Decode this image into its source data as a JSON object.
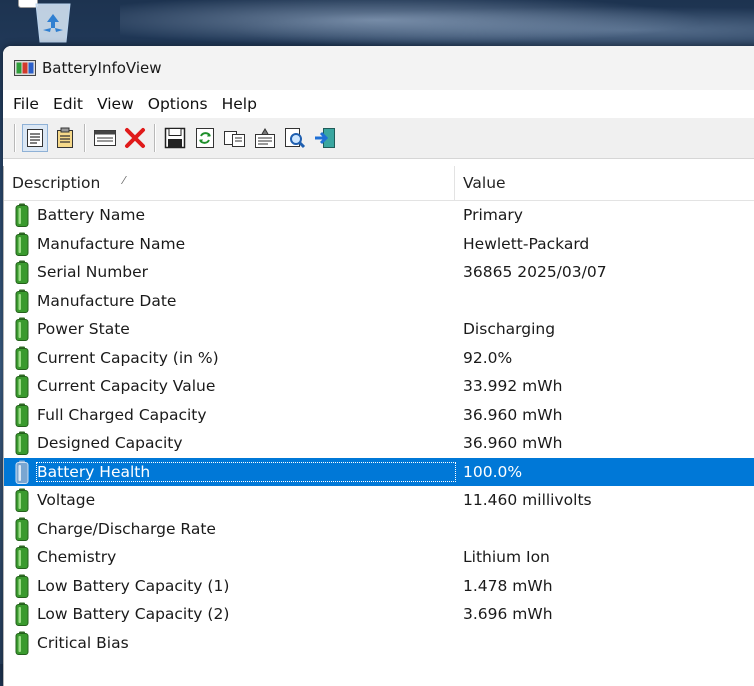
{
  "window": {
    "title": "BatteryInfoView"
  },
  "menu": [
    "File",
    "Edit",
    "View",
    "Options",
    "Help"
  ],
  "toolbar_icons": [
    "html-report-icon",
    "text-report-icon",
    "properties-window-icon",
    "delete-icon",
    "save-icon",
    "refresh-icon",
    "copy-icon",
    "properties-icon",
    "find-icon",
    "exit-icon"
  ],
  "columns": {
    "description": "Description",
    "value": "Value"
  },
  "rows": [
    {
      "description": "Battery Name",
      "value": "Primary",
      "selected": false
    },
    {
      "description": "Manufacture Name",
      "value": "Hewlett-Packard",
      "selected": false
    },
    {
      "description": "Serial Number",
      "value": "36865 2025/03/07",
      "selected": false
    },
    {
      "description": "Manufacture Date",
      "value": "",
      "selected": false
    },
    {
      "description": "Power State",
      "value": "Discharging",
      "selected": false
    },
    {
      "description": "Current Capacity (in %)",
      "value": "92.0%",
      "selected": false
    },
    {
      "description": "Current Capacity Value",
      "value": "33.992 mWh",
      "selected": false
    },
    {
      "description": "Full Charged Capacity",
      "value": "36.960 mWh",
      "selected": false
    },
    {
      "description": "Designed Capacity",
      "value": "36.960 mWh",
      "selected": false
    },
    {
      "description": "Battery Health",
      "value": "100.0%",
      "selected": true
    },
    {
      "description": "Voltage",
      "value": "11.460 millivolts",
      "selected": false
    },
    {
      "description": "Charge/Discharge Rate",
      "value": "",
      "selected": false
    },
    {
      "description": "Chemistry",
      "value": "Lithium Ion",
      "selected": false
    },
    {
      "description": "Low Battery Capacity (1)",
      "value": "1.478 mWh",
      "selected": false
    },
    {
      "description": "Low Battery Capacity (2)",
      "value": "3.696 mWh",
      "selected": false
    },
    {
      "description": "Critical Bias",
      "value": "",
      "selected": false
    }
  ],
  "colors": {
    "selection": "#0078d7",
    "battery": "#3a9a2e"
  }
}
